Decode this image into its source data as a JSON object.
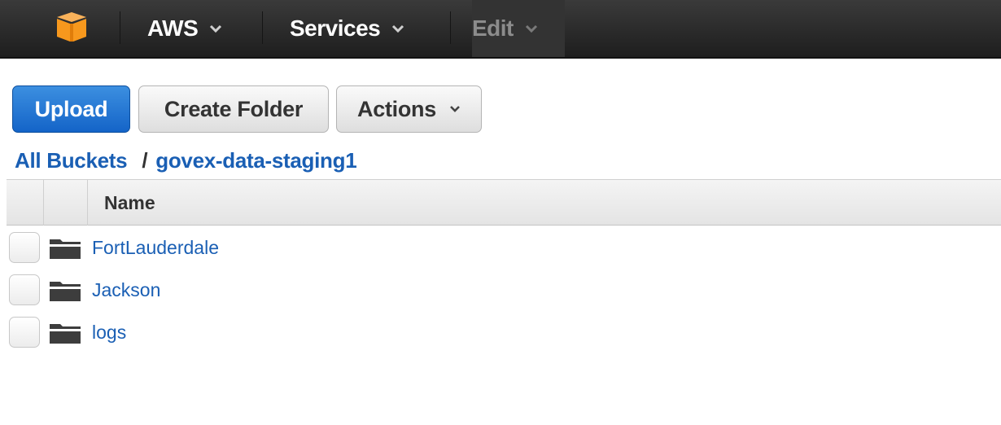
{
  "topbar": {
    "logo_icon": "aws-cube-icon",
    "nav": [
      {
        "label": "AWS",
        "disabled": false
      },
      {
        "label": "Services",
        "disabled": false
      },
      {
        "label": "Edit",
        "disabled": true
      }
    ]
  },
  "toolbar": {
    "upload_label": "Upload",
    "create_folder_label": "Create Folder",
    "actions_label": "Actions"
  },
  "breadcrumb": {
    "root": "All Buckets",
    "separator": "/",
    "current": "govex-data-staging1"
  },
  "table": {
    "columns": [
      "Name"
    ],
    "rows": [
      {
        "name": "FortLauderdale",
        "type": "folder"
      },
      {
        "name": "Jackson",
        "type": "folder"
      },
      {
        "name": "logs",
        "type": "folder"
      }
    ]
  },
  "colors": {
    "topbar": "#2b2b2b",
    "primary": "#1a6fd0",
    "link": "#1a5fb4",
    "logo": "#f7981d"
  }
}
